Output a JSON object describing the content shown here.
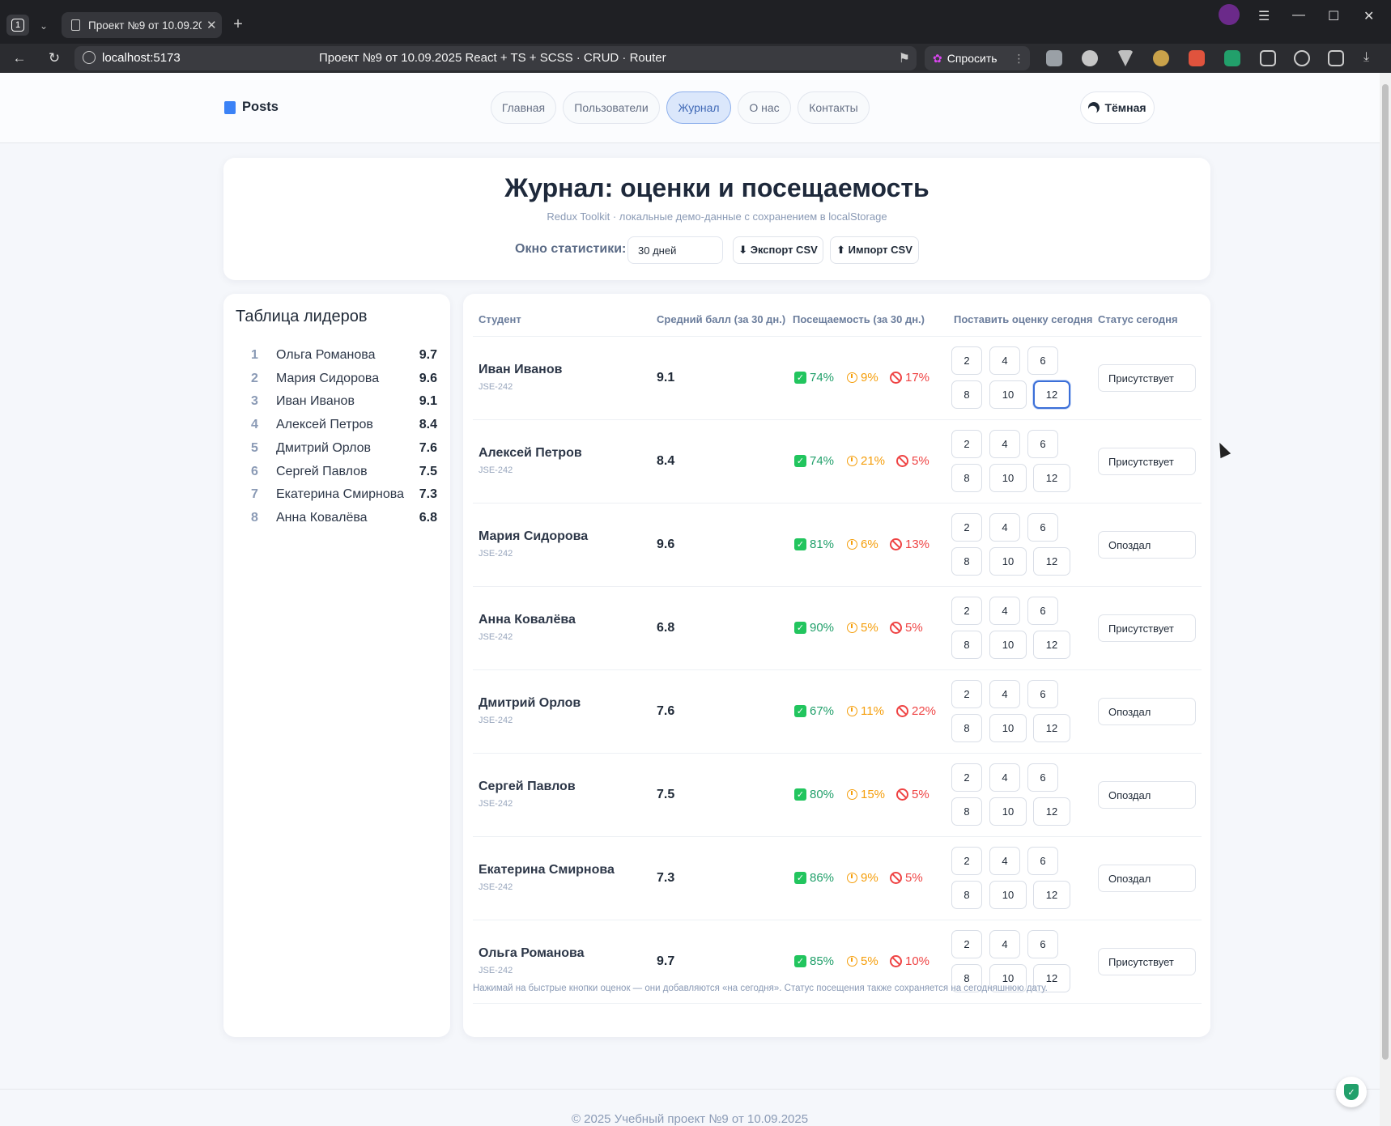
{
  "browser": {
    "tab_count": "1",
    "tab_title": "Проект №9 от 10.09.2025 React + TS + SCSS · CRUD · Router",
    "url_host": "localhost:5173",
    "page_title": "Проект №9 от 10.09.2025 React + TS + SCSS · CRUD · Router",
    "ask_label": "Спросить"
  },
  "header": {
    "brand": "Posts",
    "nav": [
      "Главная",
      "Пользователи",
      "Журнал",
      "О нас",
      "Контакты"
    ],
    "active_nav": "Журнал",
    "theme_label": "Тёмная"
  },
  "hero": {
    "title": "Журнал: оценки и посещаемость",
    "subtitle": "Redux Toolkit · локальные демо-данные с сохранением в localStorage",
    "stat_window_label": "Окно статистики:",
    "stat_window_value": "30 дней",
    "export_label": "⬇ Экспорт CSV",
    "import_label": "⬆ Импорт CSV"
  },
  "leaders": {
    "title": "Таблица лидеров",
    "items": [
      {
        "rank": "1",
        "name": "Ольга Романова",
        "score": "9.7"
      },
      {
        "rank": "2",
        "name": "Мария Сидорова",
        "score": "9.6"
      },
      {
        "rank": "3",
        "name": "Иван Иванов",
        "score": "9.1"
      },
      {
        "rank": "4",
        "name": "Алексей Петров",
        "score": "8.4"
      },
      {
        "rank": "5",
        "name": "Дмитрий Орлов",
        "score": "7.6"
      },
      {
        "rank": "6",
        "name": "Сергей Павлов",
        "score": "7.5"
      },
      {
        "rank": "7",
        "name": "Екатерина Смирнова",
        "score": "7.3"
      },
      {
        "rank": "8",
        "name": "Анна Ковалёва",
        "score": "6.8"
      }
    ]
  },
  "table": {
    "headers": [
      "Студент",
      "Средний балл (за 30 дн.)",
      "Посещаемость (за 30 дн.)",
      "Поставить оценку сегодня",
      "Статус сегодня"
    ],
    "grade_options": [
      "2",
      "4",
      "6",
      "8",
      "10",
      "12"
    ],
    "rows": [
      {
        "name": "Иван Иванов",
        "group": "JSE-242",
        "avg": "9.1",
        "present": "74%",
        "late": "9%",
        "absent": "17%",
        "status": "Присутствует",
        "selected_grade": "12"
      },
      {
        "name": "Алексей Петров",
        "group": "JSE-242",
        "avg": "8.4",
        "present": "74%",
        "late": "21%",
        "absent": "5%",
        "status": "Присутствует",
        "selected_grade": ""
      },
      {
        "name": "Мария Сидорова",
        "group": "JSE-242",
        "avg": "9.6",
        "present": "81%",
        "late": "6%",
        "absent": "13%",
        "status": "Опоздал",
        "selected_grade": ""
      },
      {
        "name": "Анна Ковалёва",
        "group": "JSE-242",
        "avg": "6.8",
        "present": "90%",
        "late": "5%",
        "absent": "5%",
        "status": "Присутствует",
        "selected_grade": ""
      },
      {
        "name": "Дмитрий Орлов",
        "group": "JSE-242",
        "avg": "7.6",
        "present": "67%",
        "late": "11%",
        "absent": "22%",
        "status": "Опоздал",
        "selected_grade": ""
      },
      {
        "name": "Сергей Павлов",
        "group": "JSE-242",
        "avg": "7.5",
        "present": "80%",
        "late": "15%",
        "absent": "5%",
        "status": "Опоздал",
        "selected_grade": ""
      },
      {
        "name": "Екатерина Смирнова",
        "group": "JSE-242",
        "avg": "7.3",
        "present": "86%",
        "late": "9%",
        "absent": "5%",
        "status": "Опоздал",
        "selected_grade": ""
      },
      {
        "name": "Ольга Романова",
        "group": "JSE-242",
        "avg": "9.7",
        "present": "85%",
        "late": "5%",
        "absent": "10%",
        "status": "Присутствует",
        "selected_grade": ""
      }
    ],
    "hint": "Нажимай на быстрые кнопки оценок — они добавляются «на сегодня». Статус посещения также сохраняется на сегодняшнюю дату."
  },
  "footer": {
    "text": "© 2025 Учебный проект №9 от 10.09.2025"
  },
  "colors": {
    "accent": "#3b6fd8",
    "present": "#22a06b",
    "late": "#f59e0b",
    "absent": "#ef4444"
  }
}
